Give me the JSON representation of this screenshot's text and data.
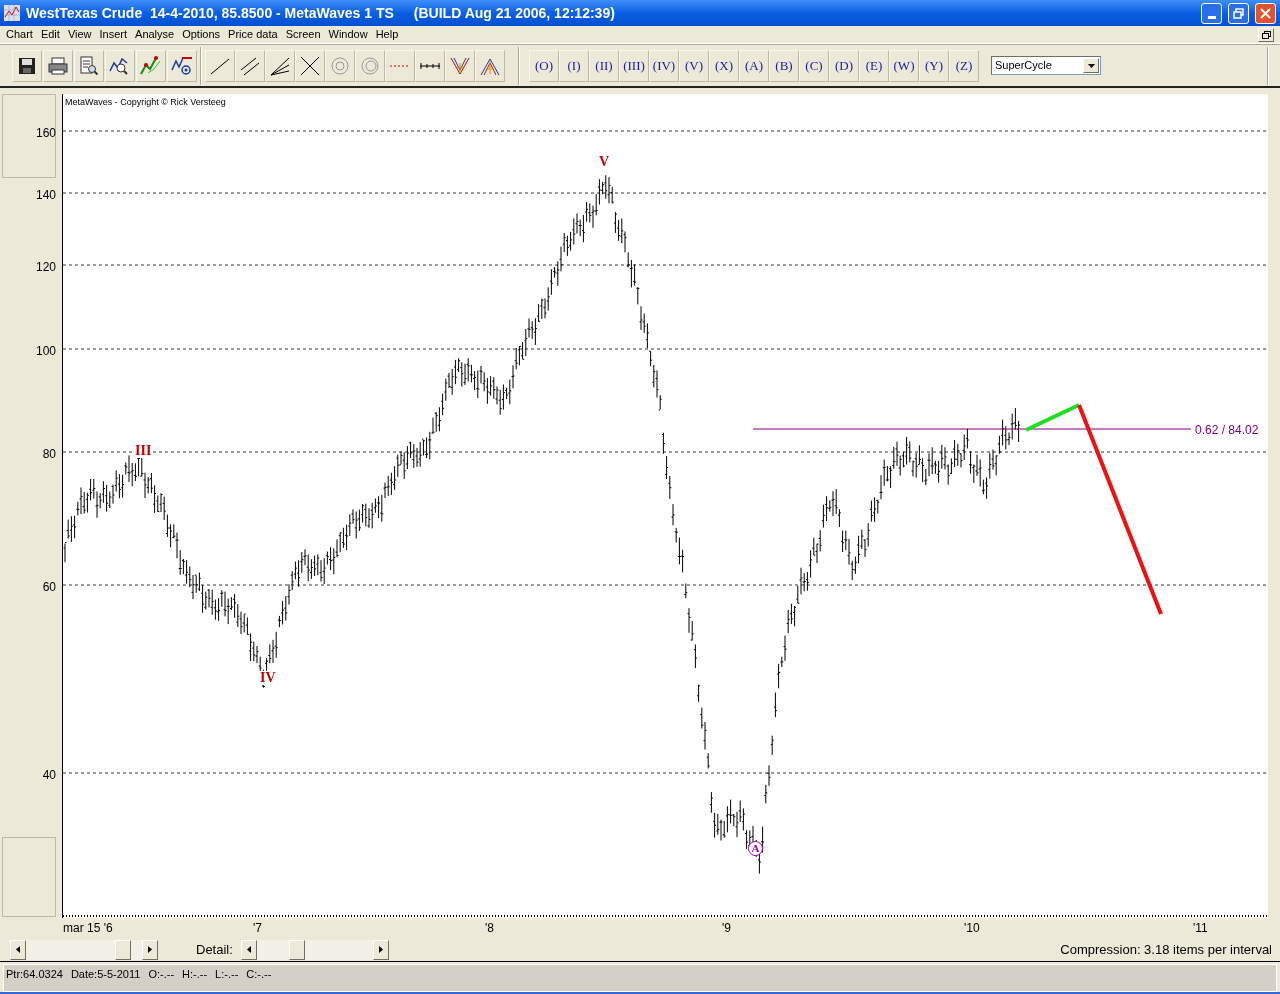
{
  "window": {
    "title": "WestTexas Crude  14-4-2010, 85.8500 - MetaWaves 1 TS",
    "build": "(BUILD Aug 21 2006, 12:12:39)"
  },
  "menu": [
    "Chart",
    "Edit",
    "View",
    "Insert",
    "Analyse",
    "Options",
    "Price data",
    "Screen",
    "Window",
    "Help"
  ],
  "wave_buttons": [
    "(O)",
    "(I)",
    "(II)",
    "(III)",
    "(IV)",
    "(V)",
    "(X)",
    "(A)",
    "(B)",
    "(C)",
    "(D)",
    "(E)",
    "(W)",
    "(Y)",
    "(Z)"
  ],
  "degree_select": {
    "value": "SuperCycle"
  },
  "chart": {
    "copyright": "MetaWaves - Copyright © Rick Versteeg",
    "y_labels": [
      "160",
      "140",
      "120",
      "100",
      "80",
      "60",
      "40"
    ],
    "x_labels": [
      "mar 15 '6",
      "'7",
      "'8",
      "'9",
      "'10",
      "'11"
    ],
    "wave_labels": [
      {
        "text": "III",
        "kind": "plain",
        "color": "#c00000"
      },
      {
        "text": "IV",
        "kind": "plain",
        "color": "#c00000"
      },
      {
        "text": "V",
        "kind": "plain",
        "color": "#c00000"
      },
      {
        "text": "A",
        "kind": "circled",
        "color": "#990099"
      }
    ],
    "fib_label": "0.62 / 84.02"
  },
  "detail_label": "Detail:",
  "compression": "Compression: 3.18 items per interval",
  "status_bar": [
    "Ptr:64.0324",
    "Date:5-5-2011",
    "O:-.--",
    "H:-.--",
    "L:-.--",
    "C:-.--"
  ]
}
